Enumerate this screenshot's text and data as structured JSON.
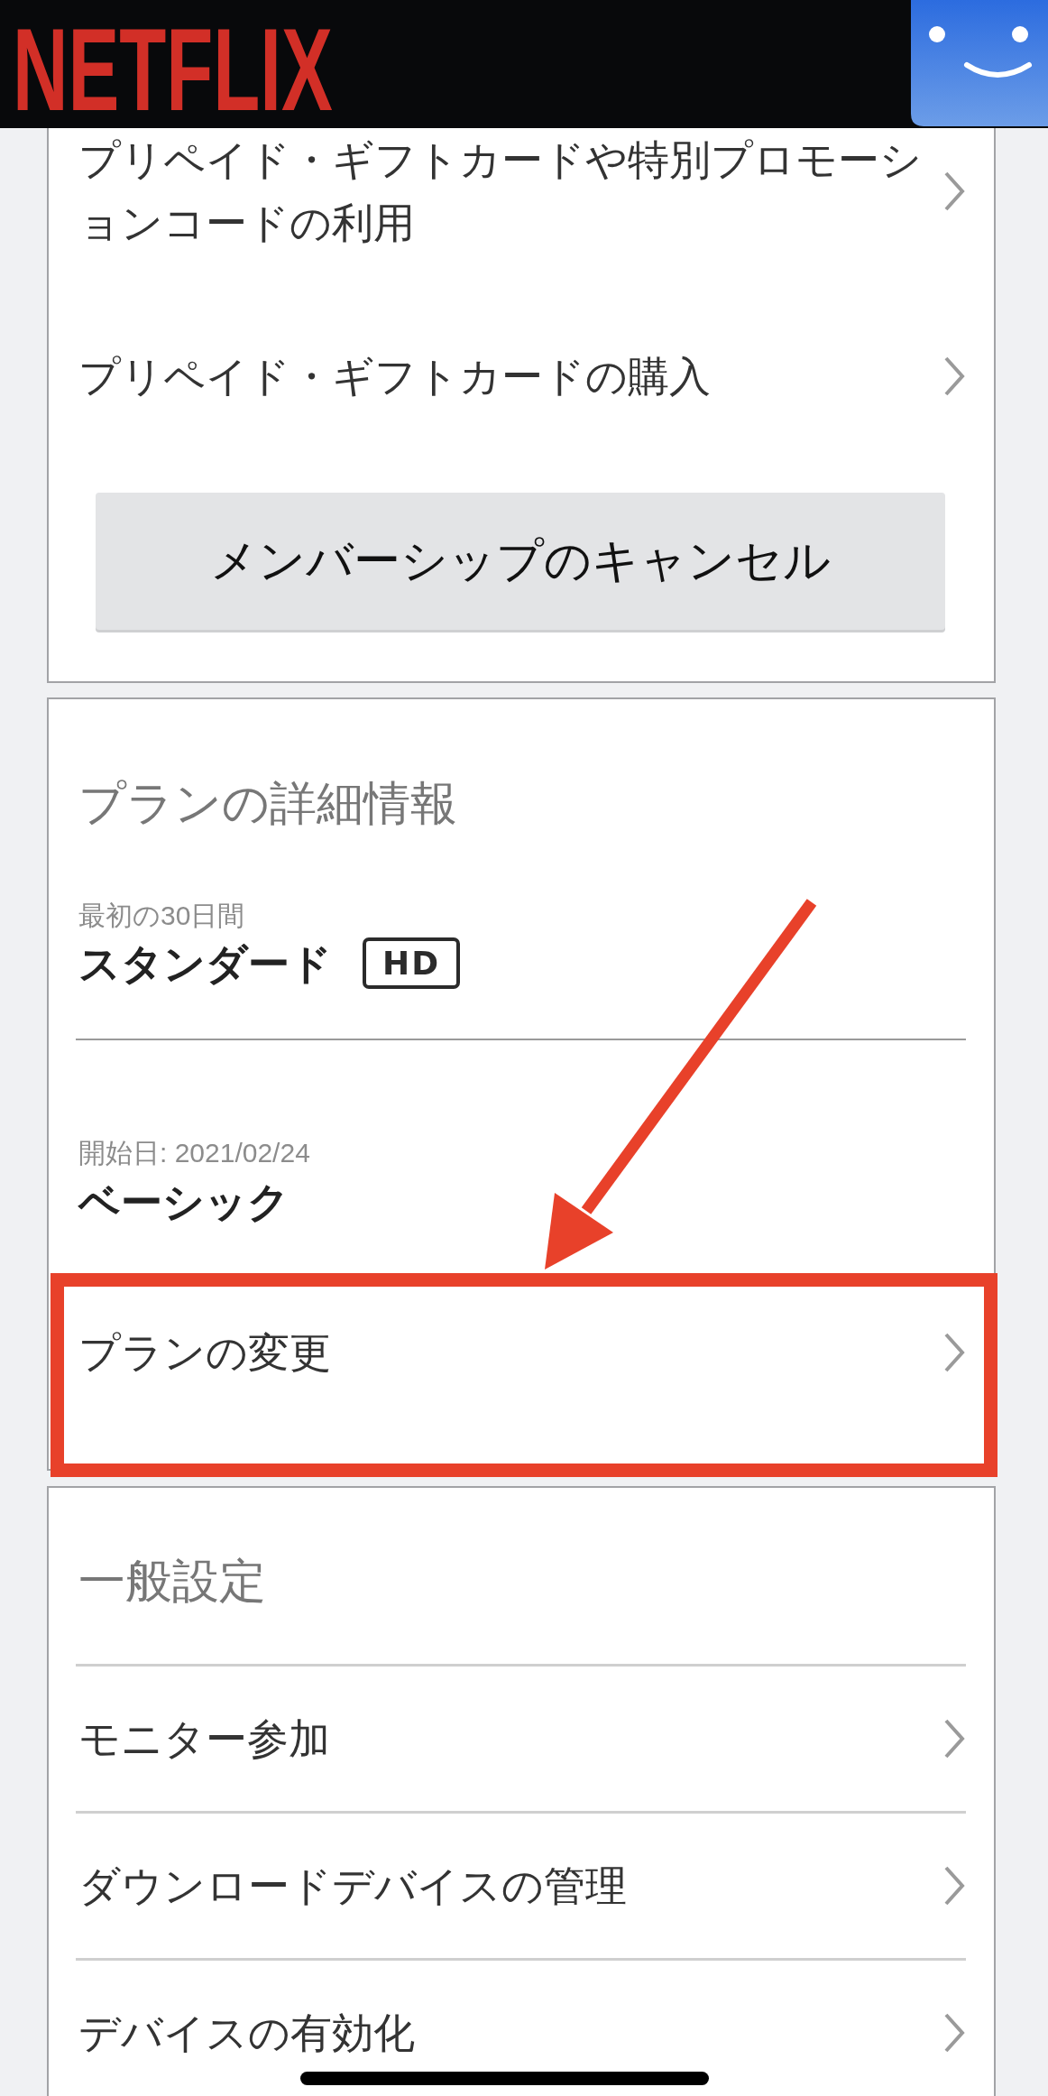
{
  "header": {
    "logo": "NETFLIX"
  },
  "membership_section": {
    "items": [
      {
        "label": "プリペイド・ギフトカードや特別プロモーションコードの利用"
      },
      {
        "label": "プリペイド・ギフトカードの購入"
      }
    ],
    "cancel_button": "メンバーシップのキャンセル"
  },
  "plan_section": {
    "title": "プランの詳細情報",
    "plans": [
      {
        "note": "最初の30日間",
        "name": "スタンダード",
        "badge": "HD"
      },
      {
        "note": "開始日: 2021/02/24",
        "name": "ベーシック"
      }
    ],
    "change_plan": {
      "label": "プランの変更",
      "highlighted": true
    }
  },
  "settings_section": {
    "title": "一般設定",
    "items": [
      {
        "label": "モニター参加"
      },
      {
        "label": "ダウンロードデバイスの管理"
      },
      {
        "label": "デバイスの有効化"
      }
    ]
  }
}
